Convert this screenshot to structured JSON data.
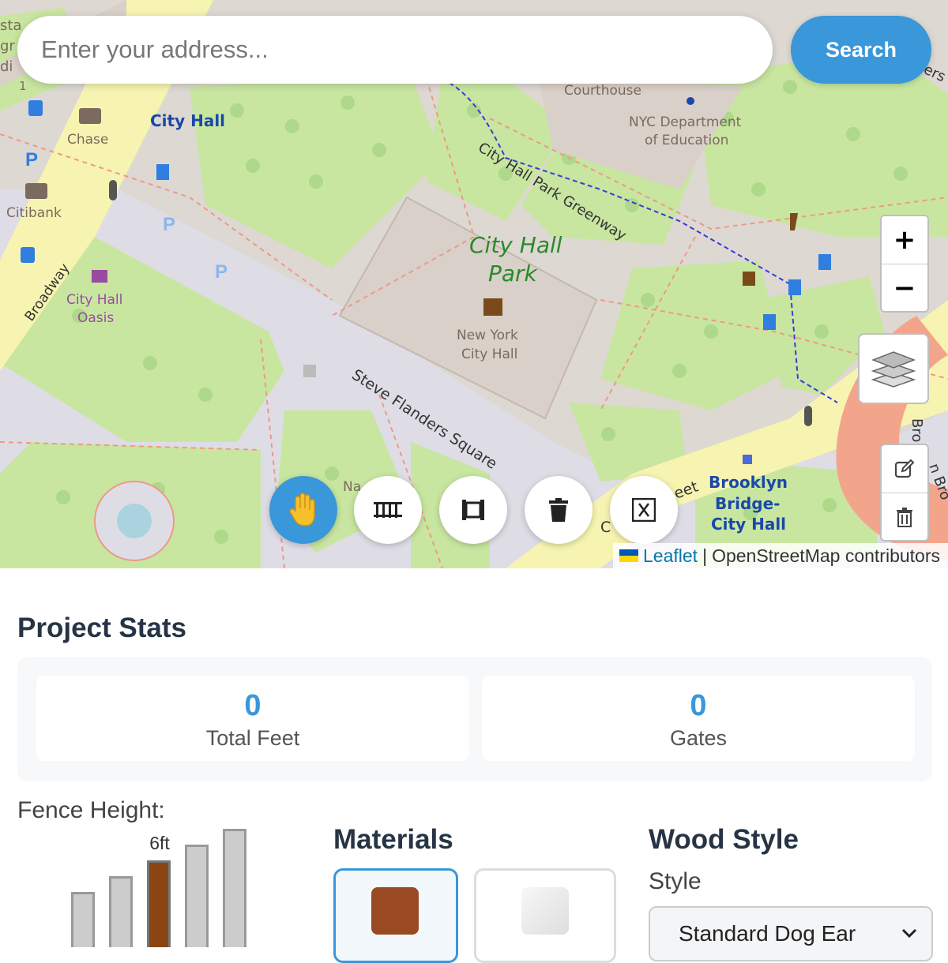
{
  "search": {
    "placeholder": "Enter your address...",
    "button_label": "Search"
  },
  "map": {
    "labels": {
      "city_hall_station": "City Hall",
      "chase": "Chase",
      "citibank": "Citibank",
      "broadway": "Broadway",
      "city_hall_oasis_1": "City Hall",
      "city_hall_oasis_2": "Oasis",
      "courthouse": "Courthouse",
      "doe_1": "NYC Department",
      "doe_2": "of Education",
      "greenway": "City Hall Park Greenway",
      "park_1": "City Hall",
      "park_2": "Park",
      "nych_1": "New York",
      "nych_2": "City Hall",
      "square": "Steve Flanders Square",
      "bb_1": "Brooklyn",
      "bb_2": "Bridge-",
      "bb_3": "City Hall",
      "eet": "eet",
      "na": "Na",
      "c": "C",
      "bro": "Bro",
      "sta": "sta",
      "gr": "gr",
      "di": "di",
      "n1": "1",
      "ers": "ers",
      "n_bro": "n Bro"
    },
    "zoom_in": "+",
    "zoom_out": "−",
    "attribution": {
      "leaflet": "Leaflet",
      "separator": "|",
      "osm": "OpenStreetMap contributors"
    }
  },
  "tools": [
    {
      "name": "pan-tool",
      "active": true
    },
    {
      "name": "fence-tool",
      "active": false
    },
    {
      "name": "gate-tool",
      "active": false
    },
    {
      "name": "delete-tool",
      "active": false
    },
    {
      "name": "clear-tool",
      "active": false
    }
  ],
  "icons": {
    "pan": "hand-icon",
    "fence": "fence-icon",
    "gate": "gate-icon",
    "delete": "trash-icon",
    "clear": "clear-icon",
    "layers": "layers-icon",
    "edit": "edit-icon",
    "draw_delete": "trash-outline-icon",
    "select": "chevron-down-icon"
  },
  "project": {
    "title": "Project Stats",
    "stats": [
      {
        "value": "0",
        "label": "Total Feet"
      },
      {
        "value": "0",
        "label": "Gates"
      }
    ]
  },
  "fence_height": {
    "label": "Fence Height:",
    "selected_label": "6ft",
    "selected_index": 2
  },
  "materials": {
    "title": "Materials",
    "options": [
      {
        "name": "wood",
        "color": "#8b4513",
        "selected": true
      },
      {
        "name": "vinyl",
        "color": "#eeeeee",
        "selected": false
      }
    ]
  },
  "wood_style": {
    "title": "Wood Style",
    "style_label": "Style",
    "selected": "Standard Dog Ear"
  },
  "colors": {
    "accent": "#3a97d9",
    "heading": "#263445",
    "wood": "#8b4513",
    "park_green": "#c8e6a0",
    "building": "#d9d0c9"
  }
}
